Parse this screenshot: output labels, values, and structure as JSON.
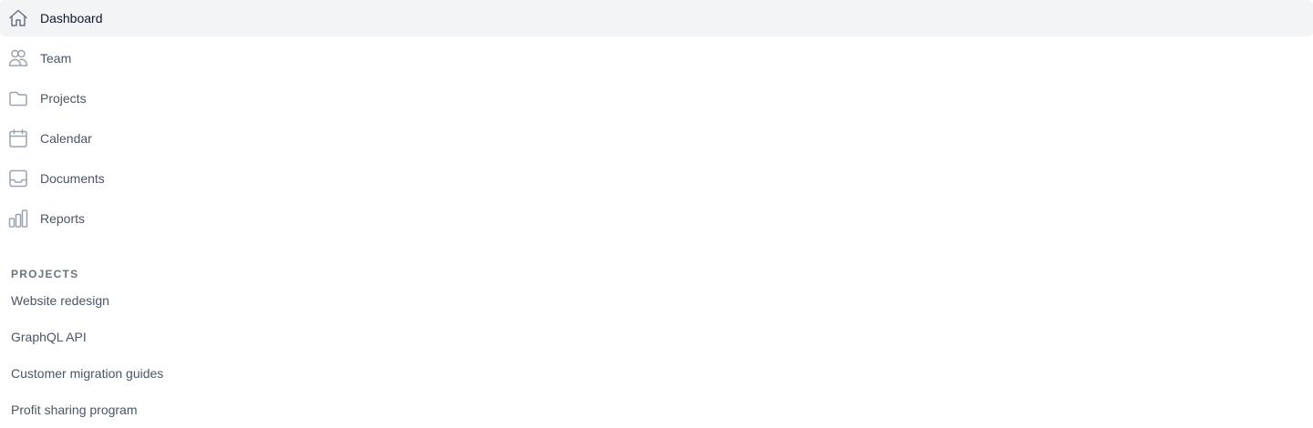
{
  "nav": {
    "items": [
      {
        "label": "Dashboard",
        "icon": "home-icon",
        "active": true
      },
      {
        "label": "Team",
        "icon": "users-icon",
        "active": false
      },
      {
        "label": "Projects",
        "icon": "folder-icon",
        "active": false
      },
      {
        "label": "Calendar",
        "icon": "calendar-icon",
        "active": false
      },
      {
        "label": "Documents",
        "icon": "inbox-icon",
        "active": false
      },
      {
        "label": "Reports",
        "icon": "chart-bar-icon",
        "active": false
      }
    ]
  },
  "projects": {
    "title": "PROJECTS",
    "items": [
      {
        "label": "Website redesign"
      },
      {
        "label": "GraphQL API"
      },
      {
        "label": "Customer migration guides"
      },
      {
        "label": "Profit sharing program"
      }
    ]
  },
  "colors": {
    "active_bg": "#f3f4f6",
    "text": "#4b5563",
    "active_text": "#111827",
    "icon": "#9ca3af",
    "active_icon": "#6b7280"
  }
}
